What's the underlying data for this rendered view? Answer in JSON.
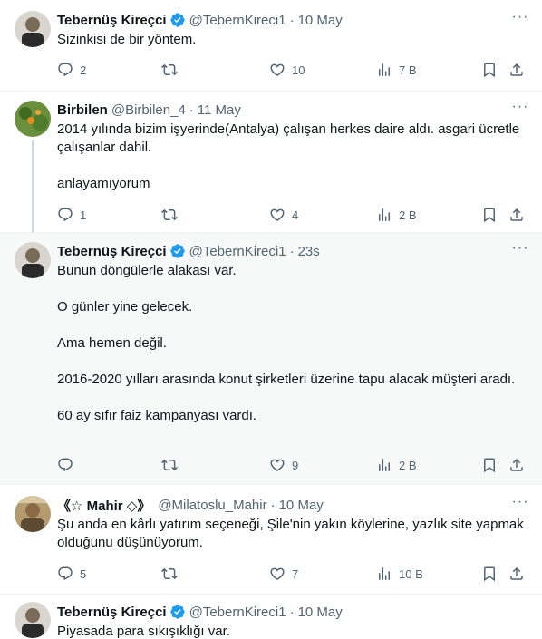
{
  "tweets": [
    {
      "name": "Tebernüş Kireçci",
      "handle": "@TebernKireci1",
      "time": "10 May",
      "text": "Sizinkisi de bir yöntem.",
      "replies": "2",
      "retweets": "",
      "likes": "10",
      "views": "7 B",
      "verified": true
    },
    {
      "name": "Birbilen",
      "handle": "@Birbilen_4",
      "time": "11 May",
      "text": "2014 yılında bizim işyerinde(Antalya) çalışan herkes daire aldı. asgari ücretle çalışanlar dahil.\n\nanlayamıyorum",
      "replies": "1",
      "retweets": "",
      "likes": "4",
      "views": "2 B",
      "verified": false
    },
    {
      "name": "Tebernüş Kireçci",
      "handle": "@TebernKireci1",
      "time": "23s",
      "text": "Bunun döngülerle alakası var.\n\nO günler yine gelecek.\n\nAma hemen değil.\n\n2016-2020 yılları arasında konut şirketleri üzerine tapu alacak müşteri aradı.\n\n60 ay sıfır faiz kampanyası vardı.",
      "replies": "",
      "retweets": "",
      "likes": "9",
      "views": "2 B",
      "verified": true
    },
    {
      "name": "《☆ Mahir ◇》",
      "handle": "@Milatoslu_Mahir",
      "time": "10 May",
      "text": "Şu anda en kârlı yatırım seçeneği, Şile'nin yakın köylerine, yazlık site yapmak olduğunu düşünüyorum.",
      "replies": "5",
      "retweets": "",
      "likes": "7",
      "views": "10 B",
      "verified": false
    },
    {
      "name": "Tebernüş Kireçci",
      "handle": "@TebernKireci1",
      "time": "10 May",
      "text": "Piyasada para sıkışıklığı var.",
      "verified": true
    }
  ],
  "colors": {
    "text": "#0f1419",
    "secondary": "#536471",
    "verified": "#1d9bf0",
    "highlight_bg": "#f7f9f9"
  },
  "icons": [
    "reply-icon",
    "retweet-icon",
    "like-icon",
    "views-icon",
    "bookmark-icon",
    "share-icon",
    "more-icon",
    "verified-badge-icon"
  ]
}
